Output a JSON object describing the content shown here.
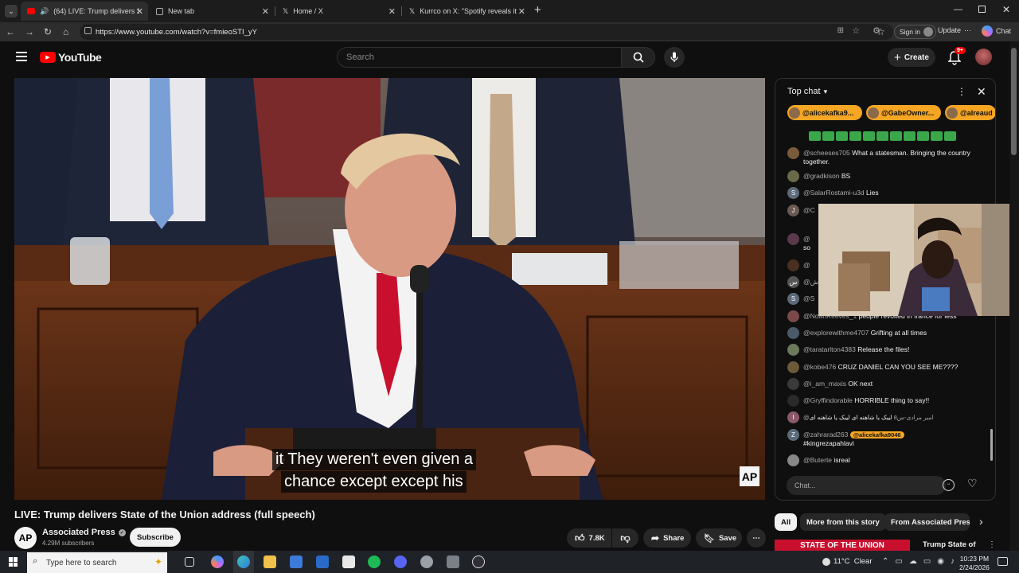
{
  "browser": {
    "tabs": [
      {
        "label": "(64) LIVE: Trump delivers State of the Union address"
      },
      {
        "label": "New tab"
      },
      {
        "label": "Home / X"
      },
      {
        "label": "Kurrco on X: \"Spotify reveals its list"
      }
    ],
    "url": "https://www.youtube.com/watch?v=fmieoSTI_yY",
    "sign_in": "Sign in",
    "update": "Update",
    "chat_btn": "Chat"
  },
  "youtube": {
    "logo": "YouTube",
    "search_placeholder": "Search",
    "create": "Create",
    "notif_badge": "9+"
  },
  "video": {
    "caption_line1": "it They weren't even given a",
    "caption_line2": "chance except except his",
    "watermark": "AP",
    "title": "LIVE: Trump delivers State of the Union address (full speech)",
    "channel": "Associated Press",
    "subscribers": "4.29M subscribers",
    "subscribe": "Subscribe",
    "likes": "7.8K",
    "share": "Share",
    "save": "Save"
  },
  "chat": {
    "header": "Top chat",
    "pinned": [
      "@alicekafka9...",
      "@GabeOwner...",
      "@alreaud"
    ],
    "messages": [
      {
        "avatar": "",
        "author": "@scheeses705",
        "text": "What a statesman. Bringing the country together."
      },
      {
        "avatar": "",
        "author": "@gradkison",
        "text": "BS"
      },
      {
        "avatar": "S",
        "author": "@SalarRostami-u3d",
        "text": "Lies"
      },
      {
        "avatar": "J",
        "author": "@C",
        "text": ""
      },
      {
        "avatar": "",
        "author": "@",
        "text": "so"
      },
      {
        "avatar": "",
        "author": "@",
        "text": ""
      },
      {
        "avatar": "س",
        "author": "@ش",
        "text": ""
      },
      {
        "avatar": "S",
        "author": "@S",
        "text": ""
      },
      {
        "avatar": "",
        "author": "@NoahReeves_1",
        "text": "people revolted in france for less"
      },
      {
        "avatar": "",
        "author": "@explorewithme4707",
        "text": "Grifting at all times"
      },
      {
        "avatar": "",
        "author": "@taratarlton4383",
        "text": "Release the files!"
      },
      {
        "avatar": "",
        "author": "@kobe476",
        "text": "CRUZ DANIEL CAN YOU SEE ME????"
      },
      {
        "avatar": "",
        "author": "@i_am_maxis",
        "text": "OK next"
      },
      {
        "avatar": "",
        "author": "@Gryffindorable",
        "text": "HORRIBLE thing to say!!"
      },
      {
        "avatar": "I",
        "author": "@امیر مرادی-س8",
        "text": "لیبک یا شاهنه ای لیبک یا شاهنه ای"
      },
      {
        "avatar": "Z",
        "author": "@zahrarad263",
        "text": "#kingrezapahlavi"
      },
      {
        "avatar": "",
        "author": "@Buterte",
        "text": "isreal"
      }
    ],
    "mention": "@alicekafka9046",
    "input_placeholder": "Chat..."
  },
  "filters": {
    "chips": [
      "All",
      "More from this story",
      "From Associated Press"
    ],
    "related_title": "Trump State of",
    "related_thumb_text": "STATE OF THE UNION"
  },
  "taskbar": {
    "search_placeholder": "Type here to search",
    "weather": "11°C  Clear",
    "time": "10:23 PM",
    "date": "2/24/2026"
  },
  "colors": {
    "yt_red": "#ff0000",
    "pinned_orange": "#f6a623",
    "ap_red": "#c8102e"
  }
}
